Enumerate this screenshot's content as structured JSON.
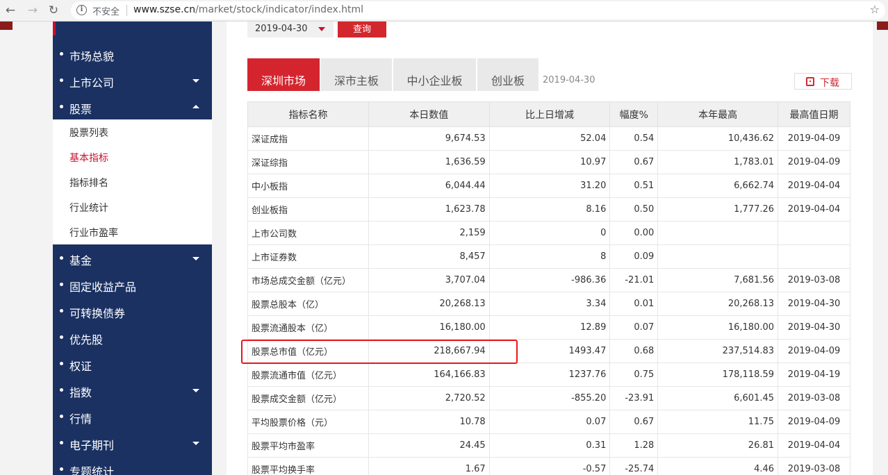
{
  "browser": {
    "back_icon": "arrow-left-icon",
    "forward_icon": "arrow-right-icon",
    "reload_icon": "reload-icon",
    "security_label": "不安全",
    "url_host": "www.szse.cn",
    "url_path": "/market/stock/indicator/index.html",
    "bookmark_icon": "star-icon"
  },
  "sidebar": {
    "items_top": [
      {
        "label": "市场总貌",
        "caret": "none"
      },
      {
        "label": "上市公司",
        "caret": "down"
      },
      {
        "label": "股票",
        "caret": "up"
      }
    ],
    "sub_items": [
      {
        "label": "股票列表",
        "active": false
      },
      {
        "label": "基本指标",
        "active": true
      },
      {
        "label": "指标排名",
        "active": false
      },
      {
        "label": "行业统计",
        "active": false
      },
      {
        "label": "行业市盈率",
        "active": false
      }
    ],
    "items_bottom": [
      {
        "label": "基金",
        "caret": "down"
      },
      {
        "label": "固定收益产品",
        "caret": "none"
      },
      {
        "label": "可转换债券",
        "caret": "none"
      },
      {
        "label": "优先股",
        "caret": "none"
      },
      {
        "label": "权证",
        "caret": "none"
      },
      {
        "label": "指数",
        "caret": "down"
      },
      {
        "label": "行情",
        "caret": "none"
      },
      {
        "label": "电子期刊",
        "caret": "down"
      },
      {
        "label": "专题统计",
        "caret": "none"
      }
    ]
  },
  "filter": {
    "date_value": "2019-04-30",
    "query_label": "查询"
  },
  "tabs": [
    {
      "label": "深圳市场",
      "active": true
    },
    {
      "label": "深市主板",
      "active": false
    },
    {
      "label": "中小企业板",
      "active": false
    },
    {
      "label": "创业板",
      "active": false
    }
  ],
  "tab_date": "2019-04-30",
  "download_label": "下载",
  "table": {
    "headers": [
      "指标名称",
      "本日数值",
      "比上日增减",
      "幅度%",
      "本年最高",
      "最高值日期"
    ],
    "rows": [
      [
        "深证成指",
        "9,674.53",
        "52.04",
        "0.54",
        "10,436.62",
        "2019-04-09"
      ],
      [
        "深证综指",
        "1,636.59",
        "10.97",
        "0.67",
        "1,783.01",
        "2019-04-09"
      ],
      [
        "中小板指",
        "6,044.44",
        "31.20",
        "0.51",
        "6,662.74",
        "2019-04-04"
      ],
      [
        "创业板指",
        "1,623.78",
        "8.16",
        "0.50",
        "1,777.26",
        "2019-04-04"
      ],
      [
        "上市公司数",
        "2,159",
        "0",
        "0.00",
        "",
        ""
      ],
      [
        "上市证券数",
        "8,457",
        "8",
        "0.09",
        "",
        ""
      ],
      [
        "市场总成交金额（亿元）",
        "3,707.04",
        "-986.36",
        "-21.01",
        "7,681.56",
        "2019-03-08"
      ],
      [
        "股票总股本（亿）",
        "20,268.13",
        "3.34",
        "0.01",
        "20,268.13",
        "2019-04-30"
      ],
      [
        "股票流通股本（亿）",
        "16,180.00",
        "12.89",
        "0.07",
        "16,180.00",
        "2019-04-30"
      ],
      [
        "股票总市值（亿元）",
        "218,667.94",
        "1493.47",
        "0.68",
        "237,514.83",
        "2019-04-09"
      ],
      [
        "股票流通市值（亿元）",
        "164,166.83",
        "1237.76",
        "0.75",
        "178,118.59",
        "2019-04-19"
      ],
      [
        "股票成交金额（亿元）",
        "2,720.52",
        "-855.20",
        "-23.91",
        "6,601.45",
        "2019-03-08"
      ],
      [
        "平均股票价格（元）",
        "10.78",
        "0.07",
        "0.67",
        "11.75",
        "2019-04-09"
      ],
      [
        "股票平均市盈率",
        "24.45",
        "0.31",
        "1.28",
        "26.81",
        "2019-04-04"
      ],
      [
        "股票平均换手率",
        "1.67",
        "-0.57",
        "-25.74",
        "4.46",
        "2019-03-08"
      ]
    ]
  },
  "colors": {
    "sidebar_bg": "#1a3162",
    "accent_red": "#d2282d",
    "highlight_border": "#e8161b"
  }
}
